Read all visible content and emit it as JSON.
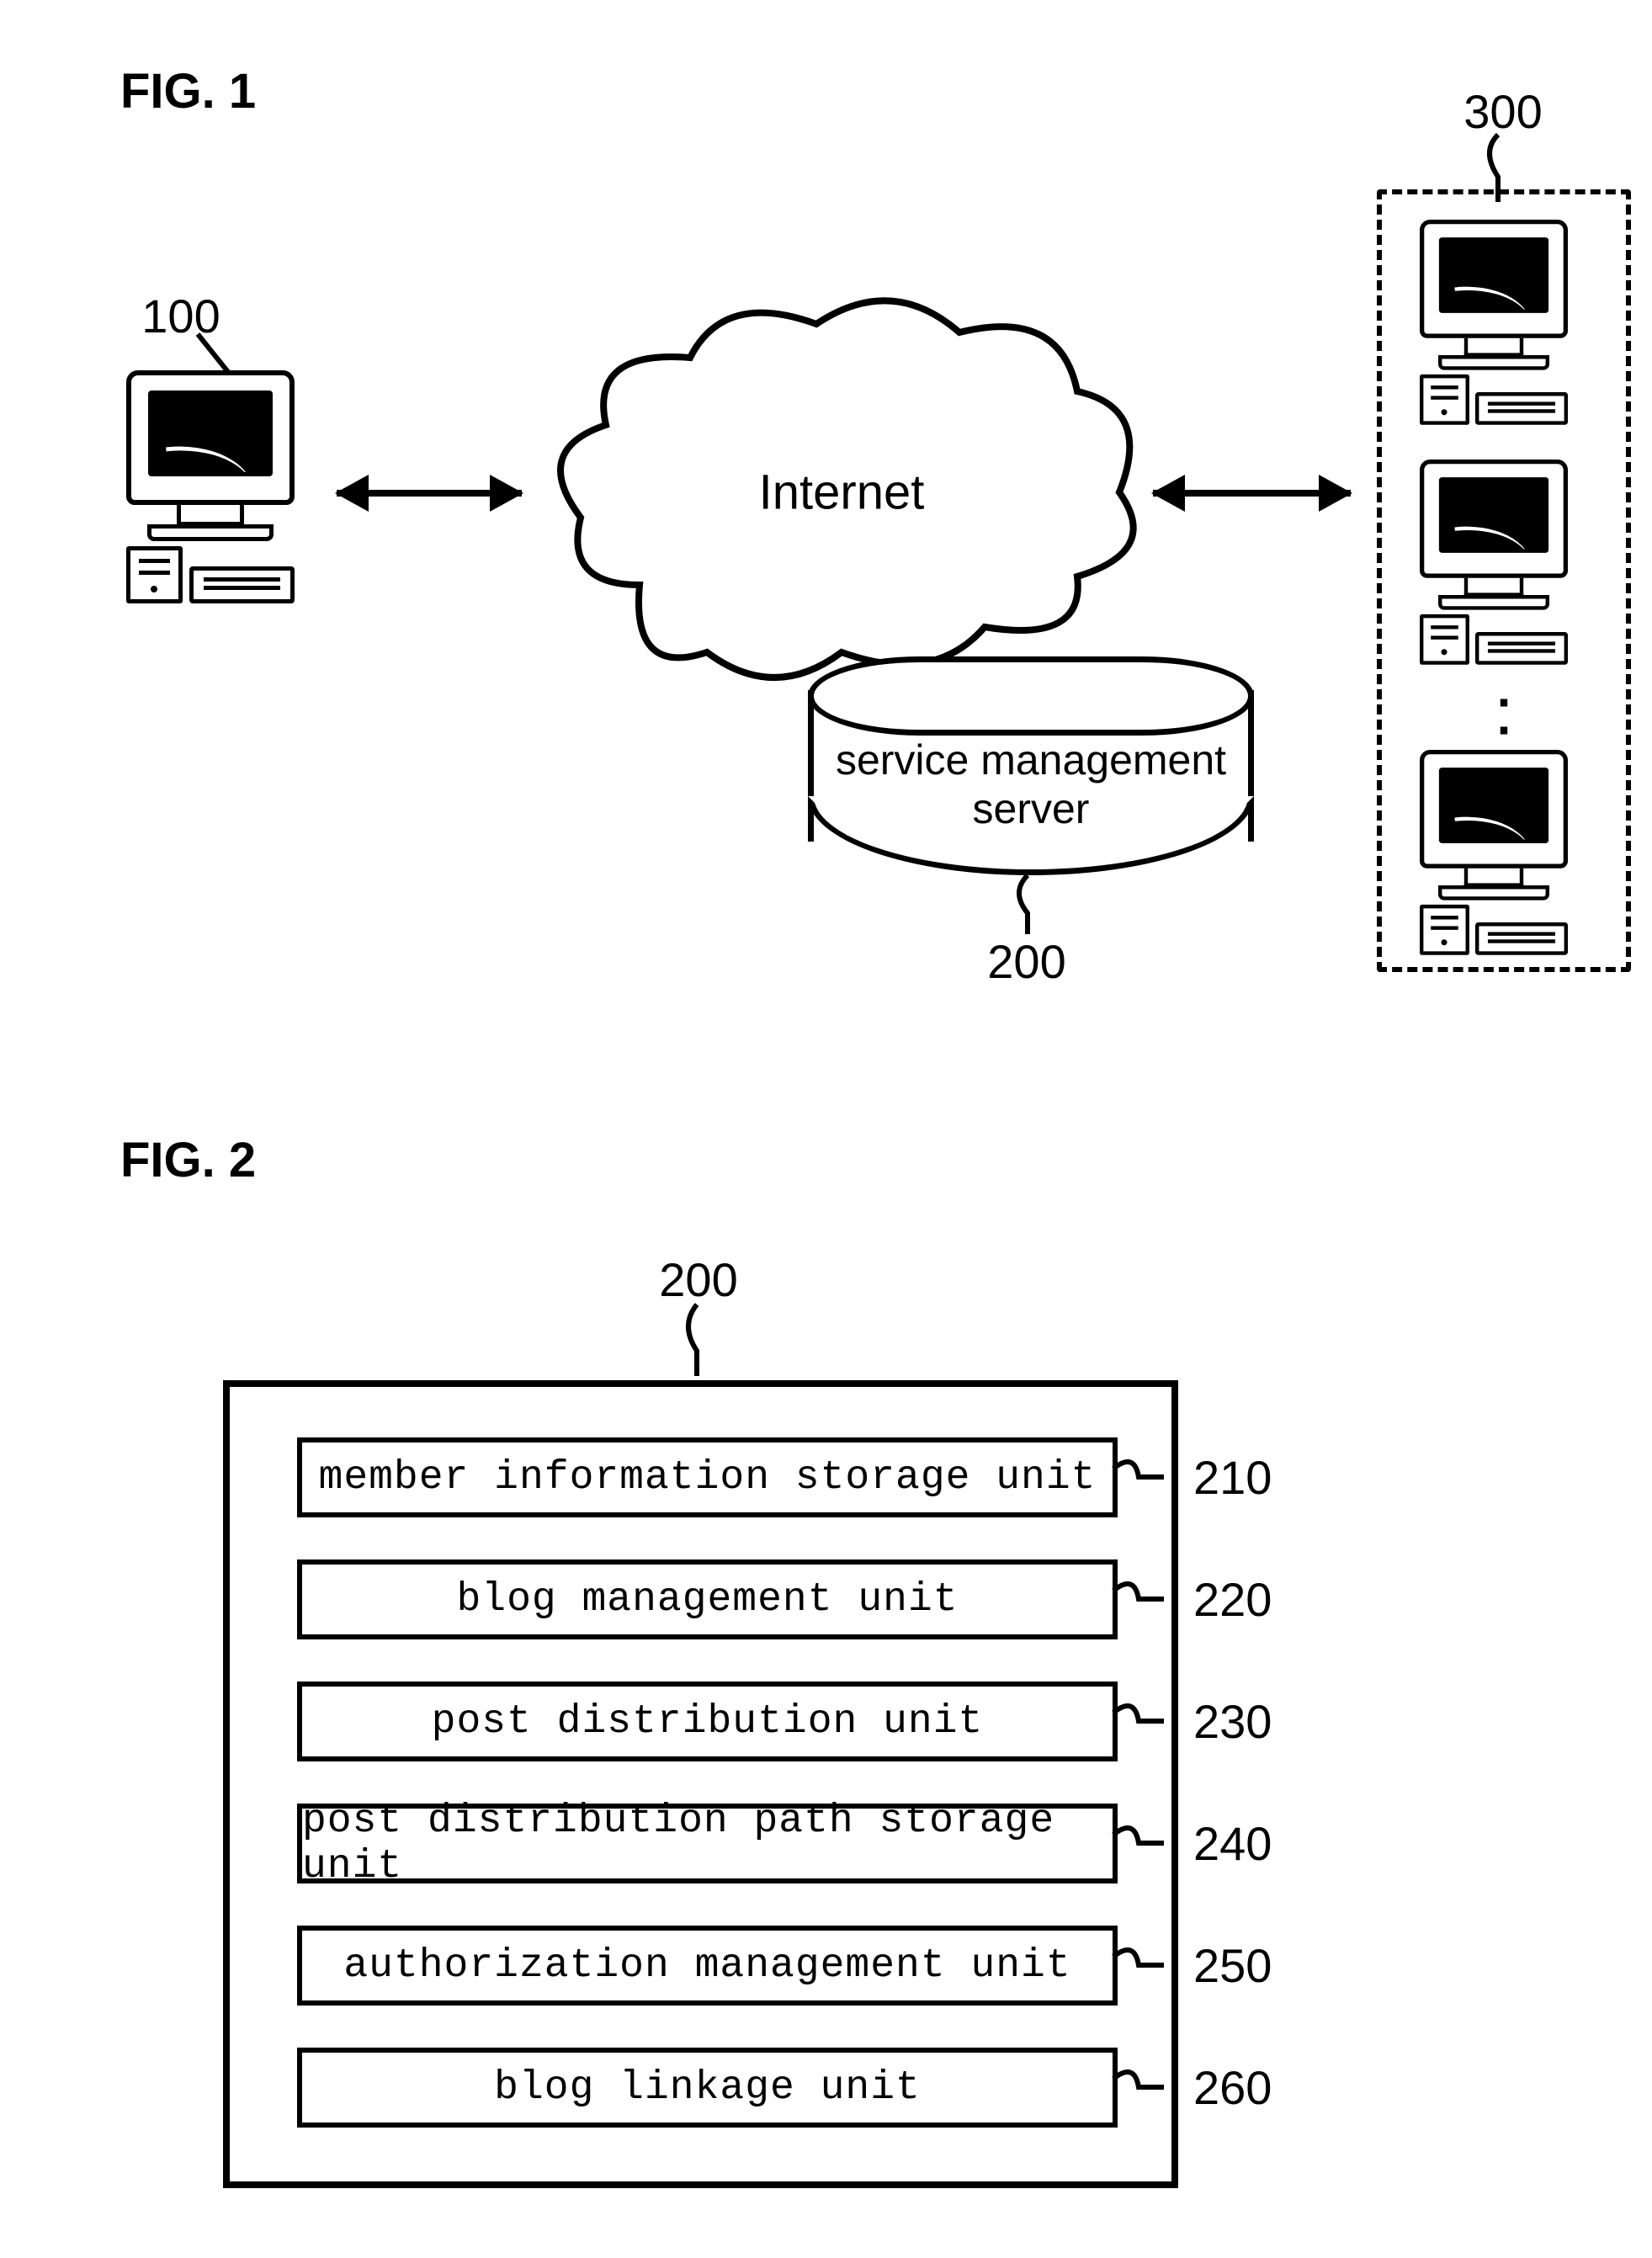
{
  "fig1": {
    "label": "FIG. 1",
    "refs": {
      "client": "100",
      "server": "200",
      "group": "300"
    },
    "cloud_label": "Internet",
    "server_label_l1": "service management",
    "server_label_l2": "server"
  },
  "fig2": {
    "label": "FIG. 2",
    "container_ref": "200",
    "units": [
      {
        "label": "member information storage unit",
        "ref": "210"
      },
      {
        "label": "blog management unit",
        "ref": "220"
      },
      {
        "label": "post distribution unit",
        "ref": "230"
      },
      {
        "label": "post distribution path storage unit",
        "ref": "240"
      },
      {
        "label": "authorization management unit",
        "ref": "250"
      },
      {
        "label": "blog linkage unit",
        "ref": "260"
      }
    ]
  }
}
